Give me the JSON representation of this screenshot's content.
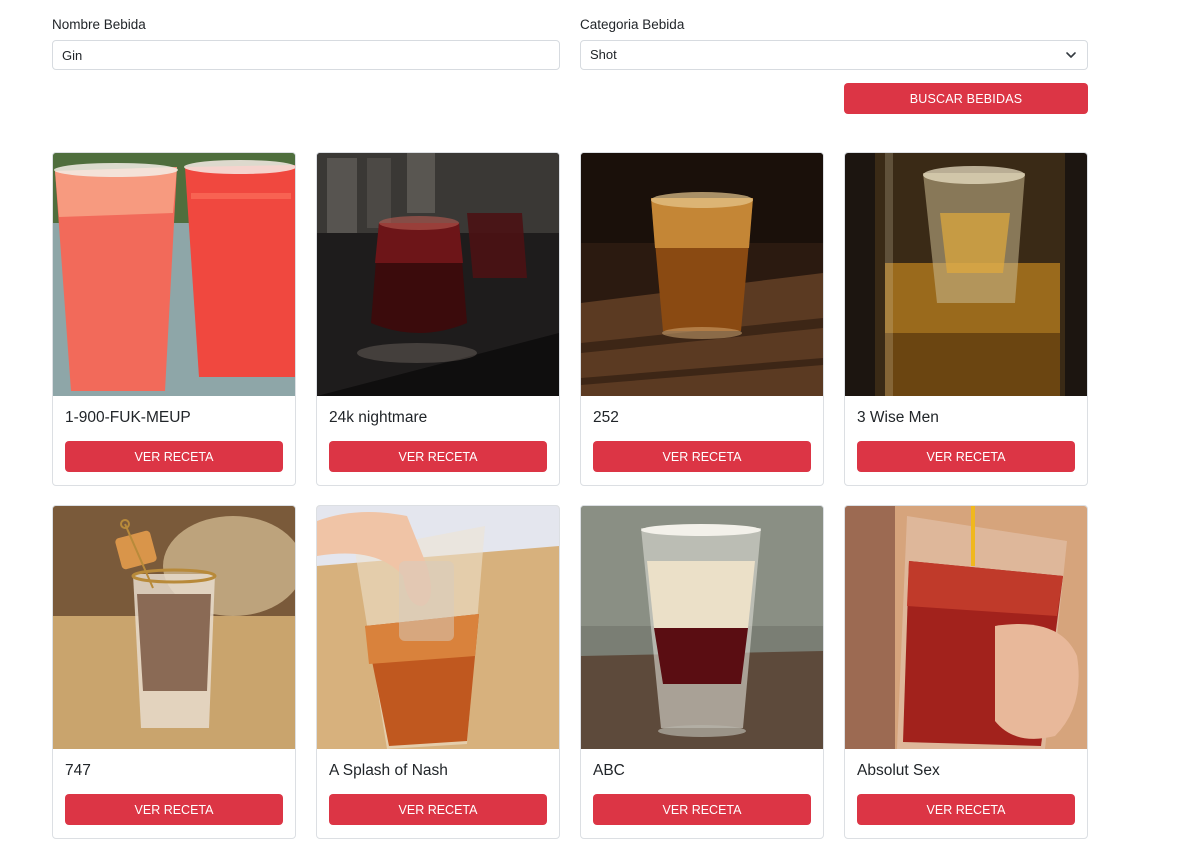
{
  "form": {
    "name_label": "Nombre Bebida",
    "name_value": "Gin",
    "category_label": "Categoria Bebida",
    "category_value": "Shot",
    "search_button": "BUSCAR BEBIDAS"
  },
  "drinks": [
    {
      "name": "1-900-FUK-MEUP",
      "button": "VER RECETA"
    },
    {
      "name": "24k nightmare",
      "button": "VER RECETA"
    },
    {
      "name": "252",
      "button": "VER RECETA"
    },
    {
      "name": "3 Wise Men",
      "button": "VER RECETA"
    },
    {
      "name": "747",
      "button": "VER RECETA"
    },
    {
      "name": "A Splash of Nash",
      "button": "VER RECETA"
    },
    {
      "name": "ABC",
      "button": "VER RECETA"
    },
    {
      "name": "Absolut Sex",
      "button": "VER RECETA"
    }
  ],
  "colors": {
    "accent": "#dc3545",
    "border": "#dcdfe3"
  },
  "icons": {
    "select_arrow": "chevron-down-icon"
  }
}
